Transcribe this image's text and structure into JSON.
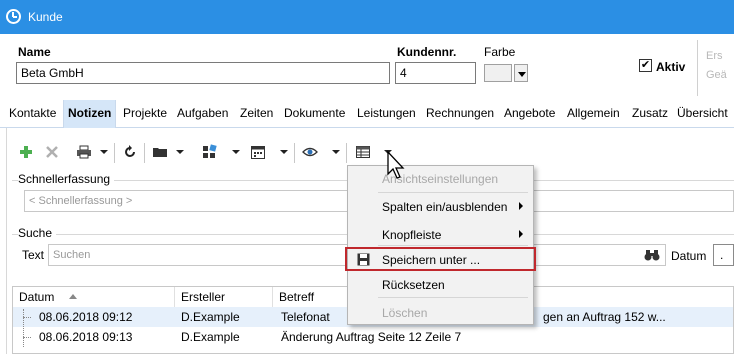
{
  "window": {
    "title": "Kunde"
  },
  "header": {
    "name_label": "Name",
    "name_value": "Beta GmbH",
    "kundennr_label": "Kundennr.",
    "kundennr_value": "4",
    "farbe_label": "Farbe",
    "aktiv_label": "Aktiv",
    "aktiv_checked": "✔",
    "faded_line1": "Ers",
    "faded_line2": "Geä"
  },
  "tabs": [
    "Kontakte",
    "Notizen",
    "Projekte",
    "Aufgaben",
    "Zeiten",
    "Dokumente",
    "Leistungen",
    "Rechnungen",
    "Angebote",
    "Allgemein",
    "Zusatz",
    "Übersicht"
  ],
  "active_tab": "Notizen",
  "toolbar": {
    "icons": [
      "add-icon",
      "delete-icon",
      "print-icon",
      "refresh-icon",
      "folder-icon",
      "modules-icon",
      "calendar-icon",
      "eye-icon",
      "view-settings-icon"
    ]
  },
  "quick_entry": {
    "title": "Schnellerfassung",
    "placeholder": "< Schnellerfassung >"
  },
  "search": {
    "title": "Suche",
    "text_label": "Text",
    "placeholder": "Suchen",
    "datum_label": "Datum",
    "datum_value": "."
  },
  "grid": {
    "columns": [
      "Datum",
      "Ersteller",
      "Betreff"
    ],
    "rows": [
      {
        "datum": "08.06.2018 09:12",
        "ersteller": "D.Example",
        "betreff": "Telefonat",
        "tail": "gen an Auftrag 152 w..."
      },
      {
        "datum": "08.06.2018 09:13",
        "ersteller": "D.Example",
        "betreff": "Änderung Auftrag Seite 12 Zeile 7",
        "tail": ""
      }
    ]
  },
  "context_menu": {
    "items": [
      {
        "label": "Ansichtseinstellungen",
        "disabled": true
      },
      {
        "label": "Spalten ein/ausblenden",
        "submenu": true
      },
      {
        "label": "Knopfleiste",
        "submenu": true
      },
      {
        "label": "Speichern unter ...",
        "highlighted": true
      },
      {
        "label": "Rücksetzen"
      },
      {
        "label": "Löschen",
        "disabled": true
      }
    ]
  },
  "colors": {
    "titlebar": "#2b8fe4",
    "active_tab": "#d5e6f8",
    "highlight_border": "#c0282d",
    "selected_row": "#e6f0fb"
  }
}
